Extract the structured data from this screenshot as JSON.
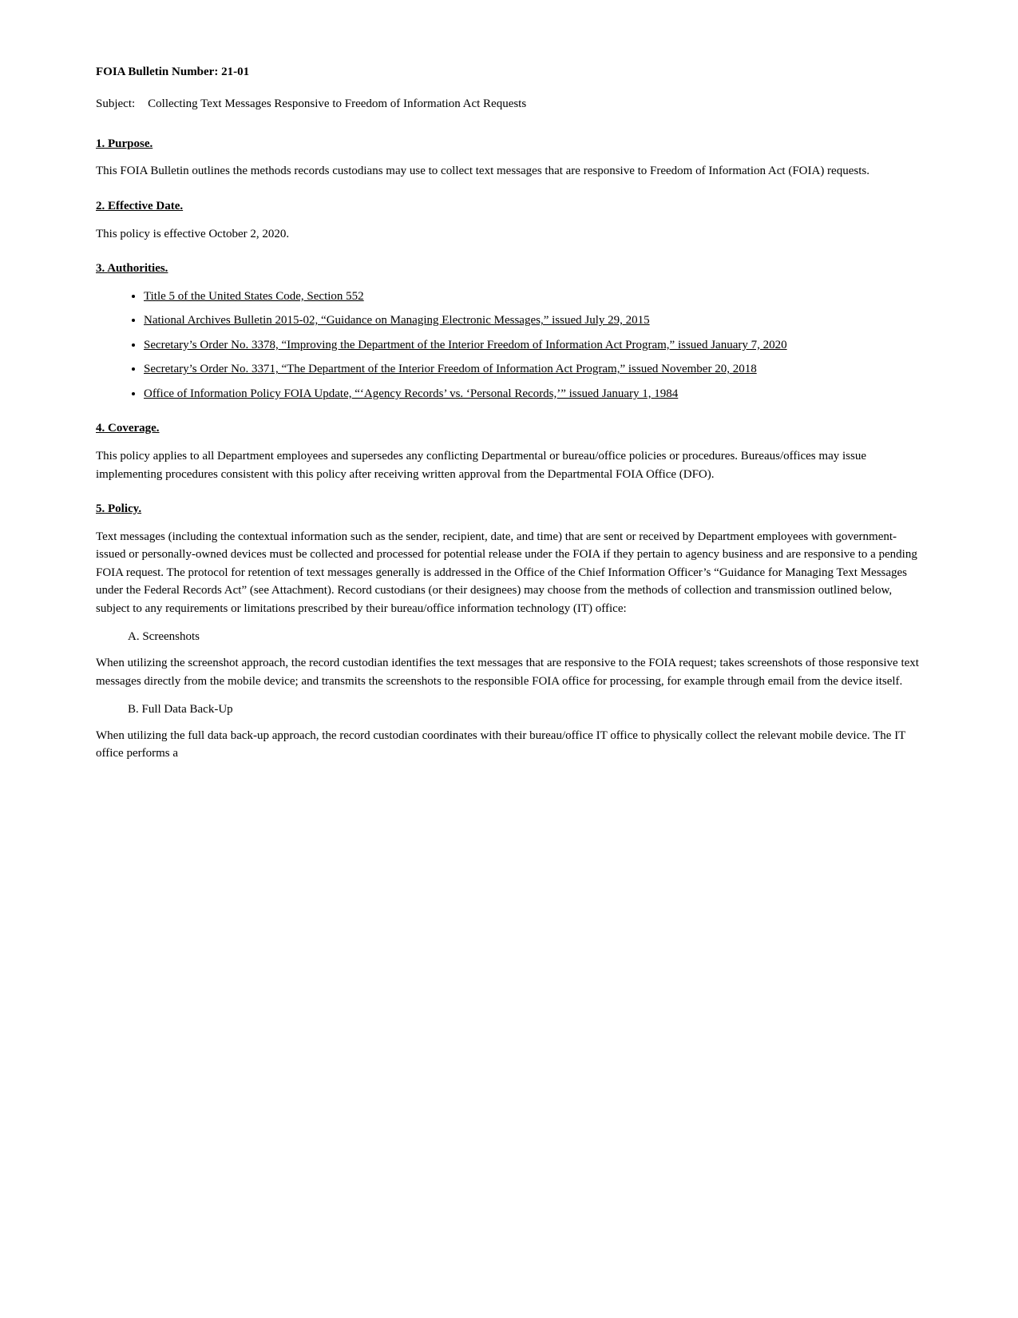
{
  "header": {
    "bulletin_label": "FOIA Bulletin Number:  21-01",
    "subject_label": "Subject:",
    "subject_text": "Collecting Text Messages Responsive to Freedom of Information Act Requests"
  },
  "sections": [
    {
      "id": "purpose",
      "num": "1.",
      "title": "Purpose.",
      "body": "This FOIA Bulletin outlines the methods records custodians may use to collect text messages that are responsive to Freedom of Information Act (FOIA) requests."
    },
    {
      "id": "effective-date",
      "num": "2.",
      "title": "Effective Date.",
      "body": "This policy is effective October 2, 2020."
    },
    {
      "id": "authorities",
      "num": "3.",
      "title": "Authorities.",
      "items": [
        "Title 5 of the United States Code, Section 552",
        "National Archives Bulletin 2015-02, “Guidance on Managing Electronic Messages,” issued July 29, 2015",
        "Secretary’s Order No. 3378, “Improving the Department of the Interior Freedom of Information Act Program,” issued January 7, 2020",
        "Secretary’s Order No. 3371, “The Department of the Interior Freedom of Information Act Program,” issued November 20, 2018",
        "Office of Information Policy FOIA Update, “‘Agency Records’ vs. ‘Personal Records,’” issued January 1, 1984"
      ]
    },
    {
      "id": "coverage",
      "num": "4.",
      "title": "Coverage.",
      "body": "This policy applies to all Department employees and supersedes any conflicting Departmental or bureau/office policies or procedures.  Bureaus/offices may issue implementing procedures consistent with this policy after receiving written approval from the Departmental FOIA Office (DFO)."
    },
    {
      "id": "policy",
      "num": "5.",
      "title": "Policy.",
      "body": "Text messages (including the contextual information such as the sender, recipient, date, and time) that are sent or received by Department employees with government-issued or personally-owned devices must be collected and processed for potential release under the FOIA if they pertain to agency business and are responsive to a pending FOIA request.  The protocol for retention of text messages generally is addressed in the Office of the Chief Information Officer’s “Guidance for Managing Text Messages under the Federal Records Act” (see Attachment).  Record custodians (or their designees) may choose from the methods of collection and transmission outlined below, subject to any requirements or limitations prescribed by their bureau/office information technology (IT) office:",
      "subsections": [
        {
          "id": "screenshots",
          "heading": "A.  Screenshots",
          "body": "When utilizing the screenshot approach, the record custodian identifies the text messages that are responsive to the FOIA request; takes screenshots of those responsive text messages directly from the mobile device; and transmits the screenshots to the responsible FOIA office for processing, for example through email from the device itself."
        },
        {
          "id": "full-data-backup",
          "heading": "B.  Full Data Back-Up",
          "body": "When utilizing the full data back-up approach, the record custodian coordinates with their bureau/office IT office to physically collect the relevant mobile device.  The IT office performs a"
        }
      ]
    }
  ]
}
